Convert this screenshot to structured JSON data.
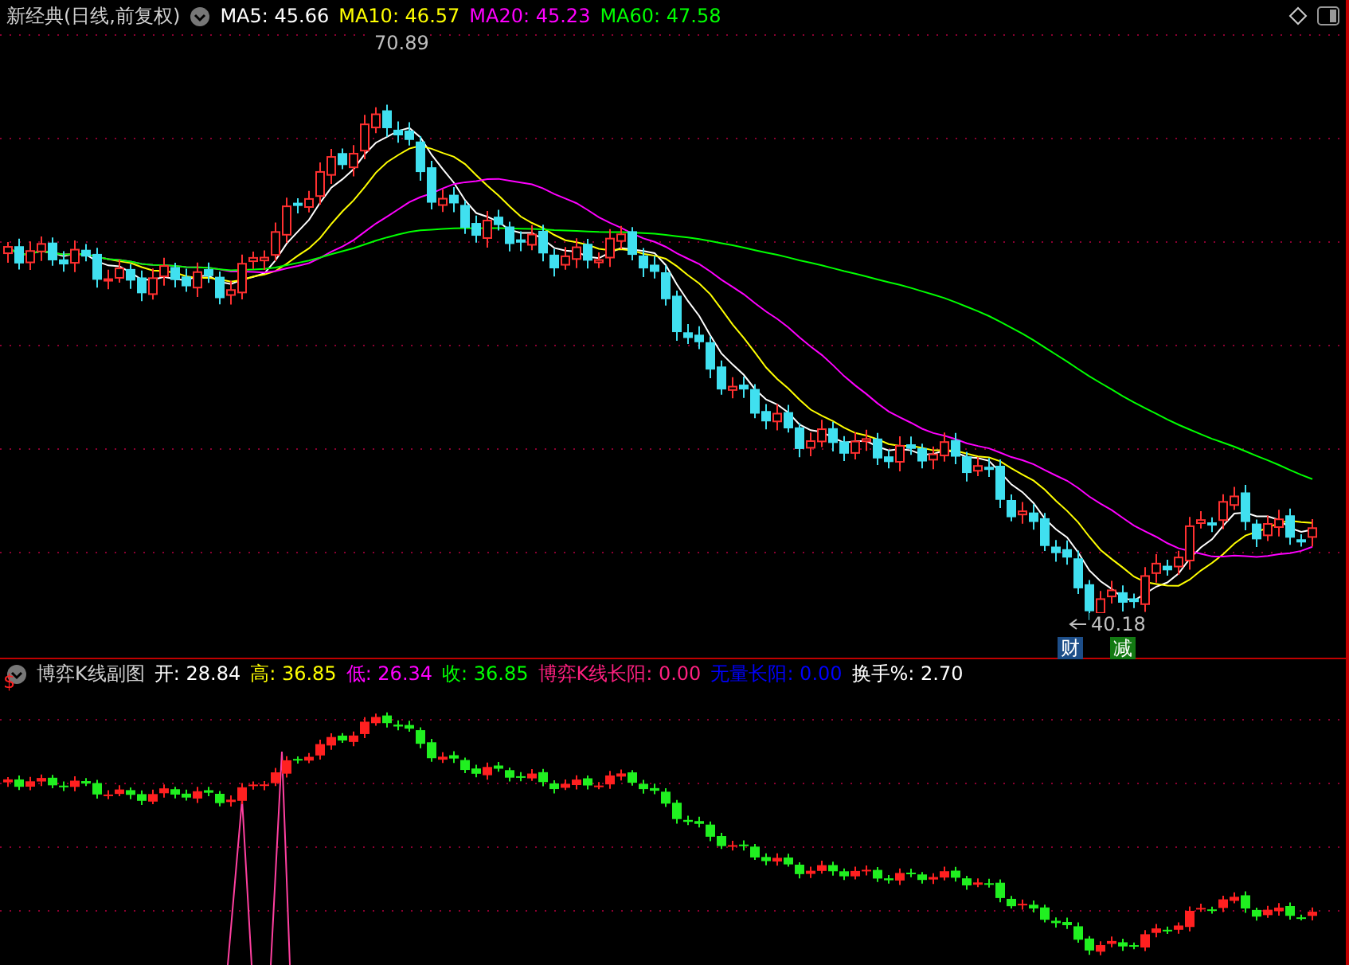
{
  "header": {
    "title": "新经典(日线,前复权)",
    "indicators": [
      {
        "label": "MA5: 45.66",
        "color": "#ffffff"
      },
      {
        "label": "MA10: 46.57",
        "color": "#ffff00"
      },
      {
        "label": "MA20: 45.23",
        "color": "#ff00ff"
      },
      {
        "label": "MA60: 47.58",
        "color": "#00ff00"
      }
    ]
  },
  "main_chart": {
    "annotations": [
      {
        "kind": "high",
        "text": "70.89"
      },
      {
        "kind": "low",
        "text": "40.18"
      }
    ],
    "signals": [
      {
        "text": "财",
        "color": "#1d4e89"
      },
      {
        "text": "减",
        "color": "#137a13"
      }
    ]
  },
  "sub_chart": {
    "marker": "$",
    "title": "博弈K线副图",
    "values": [
      {
        "label": "开: 28.84",
        "color": "#ffffff"
      },
      {
        "label": "高: 36.85",
        "color": "#ffff00"
      },
      {
        "label": "低: 26.34",
        "color": "#ff00ff"
      },
      {
        "label": "收: 36.85",
        "color": "#00ff00"
      },
      {
        "label": "博弈K线长阳: 0.00",
        "color": "#ff2080"
      },
      {
        "label": "无量长阳: 0.00",
        "color": "#0000ff"
      },
      {
        "label": "换手%: 2.70",
        "color": "#ffffff"
      }
    ]
  }
}
